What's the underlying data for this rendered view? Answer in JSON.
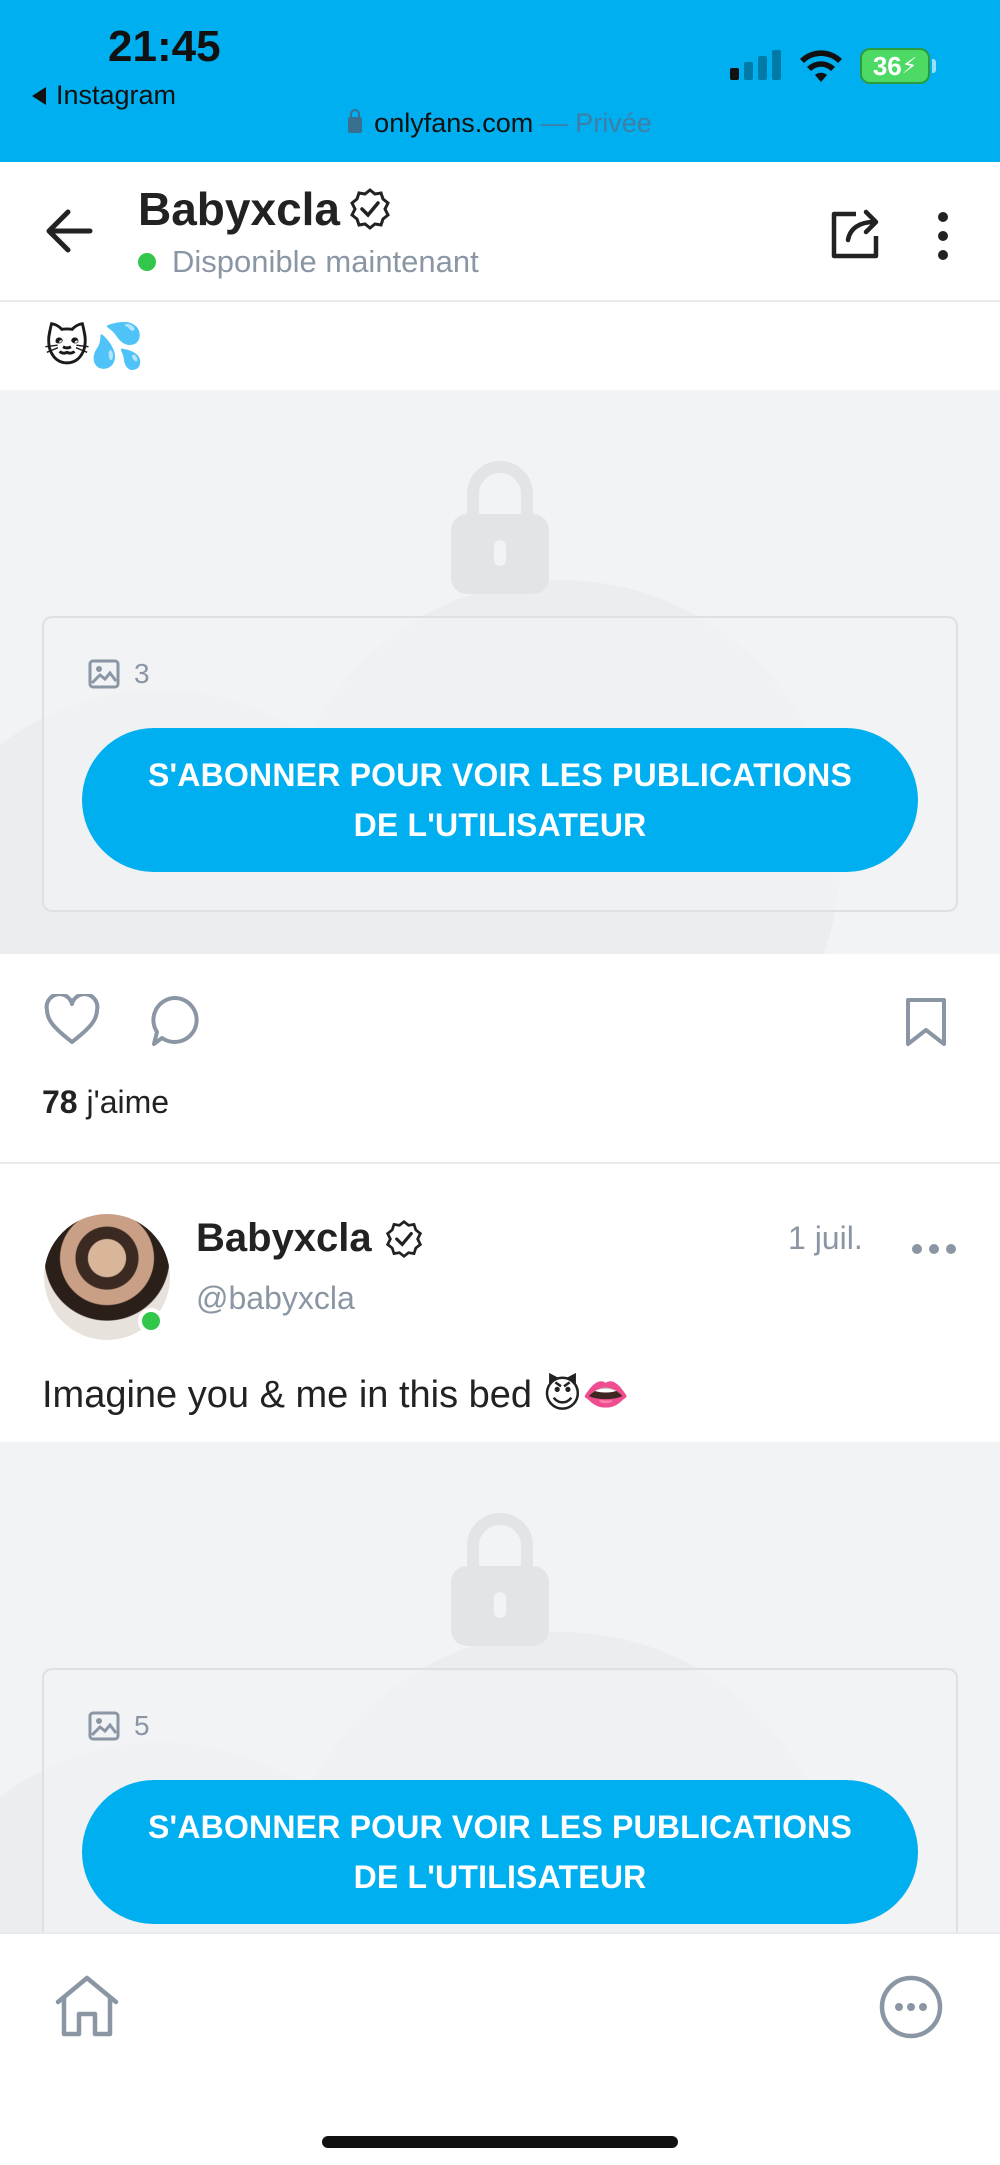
{
  "status_bar": {
    "time": "21:45",
    "back_app": "Instagram",
    "battery": "36",
    "url_domain": "onlyfans.com",
    "url_suffix": "— Privée"
  },
  "header": {
    "name": "Babyxcla",
    "status": "Disponible maintenant"
  },
  "post1": {
    "emojis": "🐱💦",
    "media_count": "3",
    "subscribe_label_line1": "S'ABONNER POUR VOIR LES PUBLICATIONS",
    "subscribe_label_line2": "DE L'UTILISATEUR",
    "likes_count": "78",
    "likes_label": "j'aime"
  },
  "post2": {
    "name": "Babyxcla",
    "handle": "@babyxcla",
    "date": "1 juil.",
    "text": "Imagine you & me in this bed 😈👄",
    "media_count": "5",
    "subscribe_label_line1": "S'ABONNER POUR VOIR LES PUBLICATIONS",
    "subscribe_label_line2": "DE L'UTILISATEUR"
  },
  "colors": {
    "brand": "#00aff0",
    "online": "#32c74a",
    "muted": "#8a96a3"
  },
  "icons": [
    "back-arrow-icon",
    "verified-icon",
    "share-icon",
    "more-vertical-icon",
    "lock-icon",
    "image-icon",
    "heart-icon",
    "comment-icon",
    "bookmark-icon",
    "more-horizontal-icon",
    "home-icon",
    "more-circle-icon"
  ]
}
